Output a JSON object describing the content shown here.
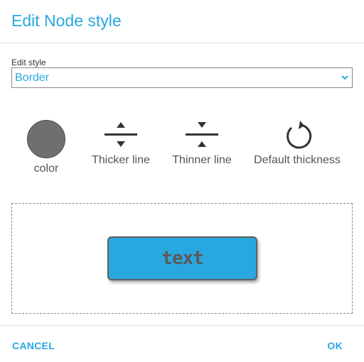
{
  "dialog": {
    "title": "Edit Node style",
    "cancel_label": "CANCEL",
    "ok_label": "OK"
  },
  "edit_style": {
    "label": "Edit style",
    "selected": "Border"
  },
  "tools": {
    "color_label": "color",
    "thicker_label": "Thicker line",
    "thinner_label": "Thinner line",
    "default_label": "Default thickness"
  },
  "preview": {
    "node_text": "text"
  },
  "colors": {
    "accent": "#29a8e0",
    "border_color_swatch": "#6f6f6f",
    "node_fill": "#29a8e0",
    "node_border": "#5f5f5f"
  }
}
